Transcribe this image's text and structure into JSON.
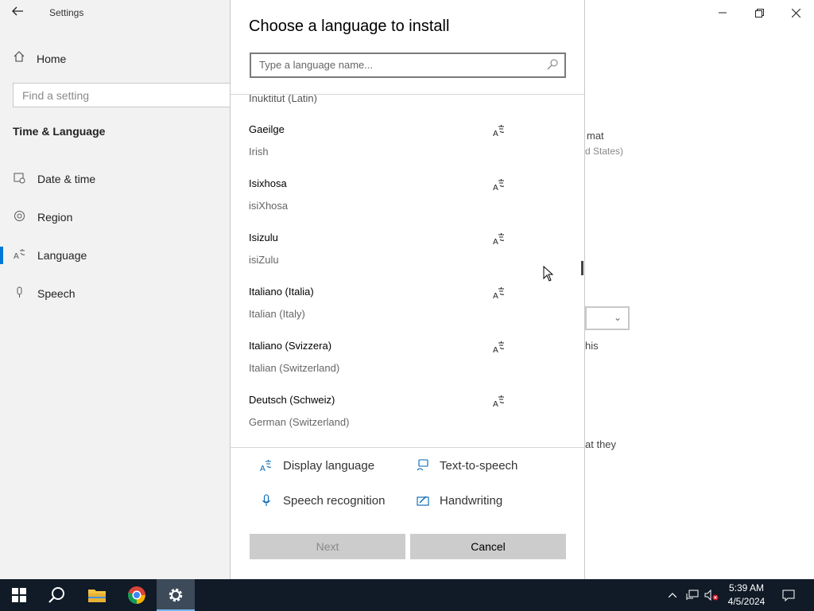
{
  "settings": {
    "app_title": "Settings",
    "home_label": "Home",
    "search_placeholder": "Find a setting",
    "section_title": "Time & Language",
    "nav_items": [
      {
        "label": "Date & time",
        "icon": "date-time-icon"
      },
      {
        "label": "Region",
        "icon": "region-icon"
      },
      {
        "label": "Language",
        "icon": "language-icon",
        "active": true
      },
      {
        "label": "Speech",
        "icon": "microphone-icon"
      }
    ],
    "background_fragments": {
      "format": "mat",
      "format_sub": "d States)",
      "his": "his",
      "at_they": "at they"
    }
  },
  "dialog": {
    "title": "Choose a language to install",
    "search_placeholder": "Type a language name...",
    "partial_item": "Inuktitut (Latin)",
    "languages": [
      {
        "native": "Gaeilge",
        "english": "Irish"
      },
      {
        "native": "Isixhosa",
        "english": "isiXhosa"
      },
      {
        "native": "Isizulu",
        "english": "isiZulu"
      },
      {
        "native": "Italiano (Italia)",
        "english": "Italian (Italy)"
      },
      {
        "native": "Italiano (Svizzera)",
        "english": "Italian (Switzerland)"
      },
      {
        "native": "Deutsch (Schweiz)",
        "english": "German (Switzerland)"
      }
    ],
    "features": {
      "display_language": "Display language",
      "text_to_speech": "Text-to-speech",
      "speech_recognition": "Speech recognition",
      "handwriting": "Handwriting"
    },
    "buttons": {
      "next": "Next",
      "cancel": "Cancel"
    }
  },
  "taskbar": {
    "time": "5:39 AM",
    "date": "4/5/2024"
  },
  "colors": {
    "accent": "#0078d7",
    "feature_icon": "#0063b1",
    "taskbar": "#101b27"
  }
}
